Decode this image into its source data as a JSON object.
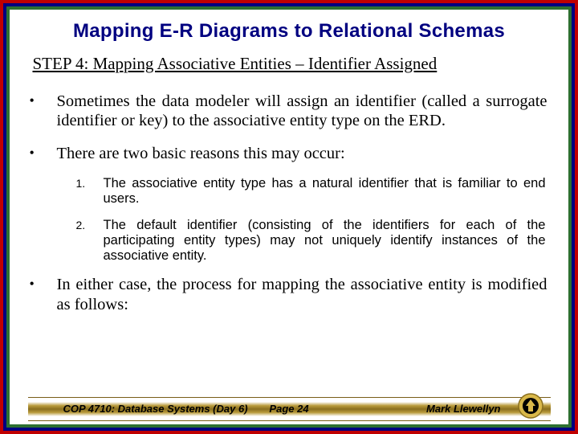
{
  "title": "Mapping E-R Diagrams to Relational Schemas",
  "subhead": "STEP 4:  Mapping Associative Entities – Identifier Assigned",
  "bullets": [
    "Sometimes the data modeler will assign an identifier (called a surrogate identifier or key) to the associative entity type on the ERD.",
    "There are two basic reasons this may occur:",
    "In either case, the process for mapping the associative entity is modified as follows:"
  ],
  "sub_bullets": [
    "The associative entity type has a natural identifier that is familiar to end users.",
    "The default identifier (consisting of the identifiers for each of the participating entity types) may not uniquely identify instances of the associative entity."
  ],
  "footer": {
    "left": "COP 4710: Database Systems  (Day 6)",
    "center": "Page 24",
    "right": "Mark Llewellyn"
  }
}
